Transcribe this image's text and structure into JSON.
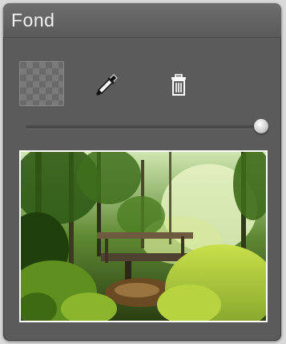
{
  "panel": {
    "title": "Fond"
  },
  "background": {
    "swatch_icon": "transparent-checkerboard-swatch",
    "tools": [
      {
        "name": "eyedropper",
        "icon": "eyedropper-icon"
      },
      {
        "name": "delete",
        "icon": "trash-icon"
      }
    ],
    "opacity_slider": {
      "value": 1.0
    },
    "preview_image": {
      "subject": "forest-bridge-photo"
    }
  },
  "colors": {
    "panel_bg": "#5b5b5b",
    "header_bg": "#666666",
    "title_text": "#f2f2f2",
    "preview_border": "#ffffff"
  }
}
